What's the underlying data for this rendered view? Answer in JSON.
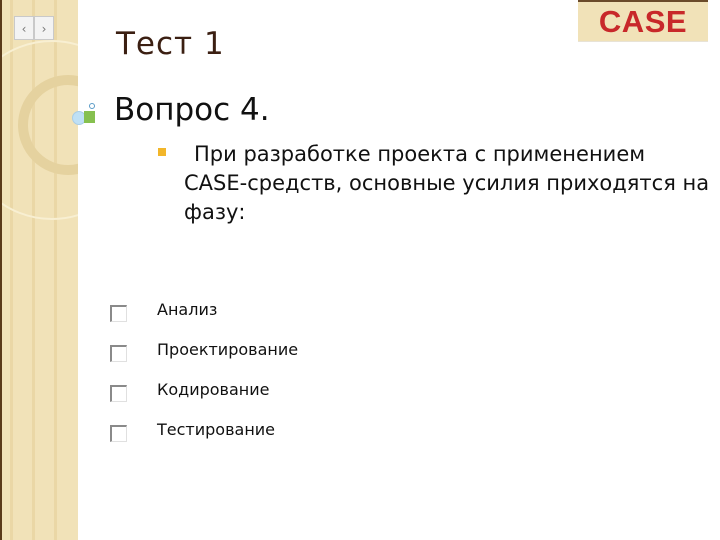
{
  "navigation": {
    "prev_icon": "‹",
    "next_icon": "›"
  },
  "header": {
    "title": "Тест 1",
    "badge": "CASE"
  },
  "question": {
    "heading": "Вопрос 4.",
    "prompt": "При разработке проекта с применением CASE-средств, основные усилия приходятся на фазу:"
  },
  "options": [
    {
      "label": "Анализ",
      "checked": false
    },
    {
      "label": "Проектирование",
      "checked": false
    },
    {
      "label": "Кодирование",
      "checked": false
    },
    {
      "label": "Тестирование",
      "checked": false
    }
  ],
  "colors": {
    "sidebar": "#f1e2b8",
    "badge_text": "#c8282a",
    "bullet": "#f2b62a",
    "title": "#3b1f12"
  }
}
